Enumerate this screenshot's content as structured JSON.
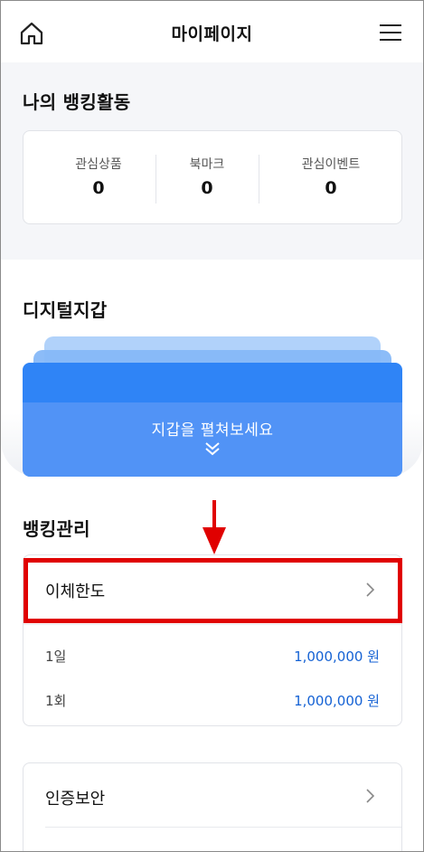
{
  "header": {
    "title": "마이페이지",
    "home_icon": "home-icon",
    "menu_icon": "hamburger-menu-icon"
  },
  "activity": {
    "title": "나의 뱅킹활동",
    "stats": [
      {
        "label": "관심상품",
        "value": "0"
      },
      {
        "label": "북마크",
        "value": "0"
      },
      {
        "label": "관심이벤트",
        "value": "0"
      }
    ]
  },
  "wallet": {
    "title": "디지털지갑",
    "cta": "지갑을 펼쳐보세요",
    "card_color": "#2f84f6"
  },
  "management": {
    "title": "뱅킹관리",
    "transfer_limit": {
      "label": "이체한도",
      "rows": [
        {
          "label": "1일",
          "value": "1,000,000 원"
        },
        {
          "label": "1회",
          "value": "1,000,000 원"
        }
      ]
    },
    "auth_security": {
      "label": "인증보안"
    }
  },
  "colors": {
    "accent": "#1562d4",
    "highlight": "#e00000",
    "section_bg": "#f5f6f9"
  }
}
